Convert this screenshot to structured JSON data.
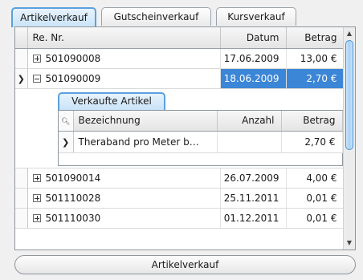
{
  "tabs": [
    "Artikelverkauf",
    "Gutscheinverkauf",
    "Kursverkauf"
  ],
  "grid": {
    "columns": [
      "Re. Nr.",
      "Datum",
      "Betrag"
    ],
    "rows": [
      {
        "nr": "501090008",
        "datum": "17.06.2009",
        "betrag": "13,00 €",
        "expanded": false
      },
      {
        "nr": "501090009",
        "datum": "18.06.2009",
        "betrag": "2,70 €",
        "expanded": true,
        "selected": true
      },
      {
        "nr": "501090014",
        "datum": "26.07.2009",
        "betrag": "4,00 €",
        "expanded": false
      },
      {
        "nr": "501110028",
        "datum": "25.11.2011",
        "betrag": "0,01 €",
        "expanded": false
      },
      {
        "nr": "501110030",
        "datum": "01.12.2011",
        "betrag": "0,01 €",
        "expanded": false
      }
    ]
  },
  "detail": {
    "tab": "Verkaufte Artikel",
    "columns": [
      "Bezeichnung",
      "Anzahl",
      "Betrag"
    ],
    "rows": [
      {
        "bezeichnung": "Theraband pro Meter b…",
        "anzahl": "",
        "betrag": "2,70 €"
      }
    ]
  },
  "bottom_label": "Artikelverkauf",
  "colors": {
    "accent": "#3b86d6",
    "tab_border": "#5aa0de"
  },
  "icons": {
    "expand": "plus-box-icon",
    "collapse": "minus-box-icon",
    "row_pointer": "chevron-right-icon",
    "filter": "search-icon"
  }
}
